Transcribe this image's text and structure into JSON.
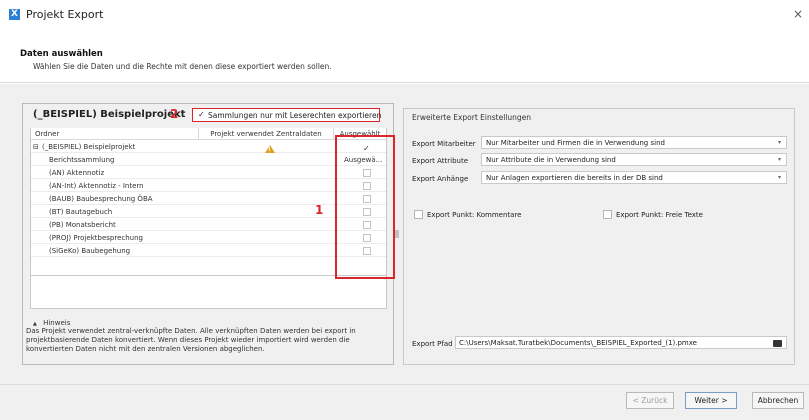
{
  "window": {
    "title": "Projekt Export",
    "close_glyph": "×"
  },
  "header": {
    "title": "Daten auswählen",
    "subtitle": "Wählen Sie die Daten und die Rechte mit denen diese exportiert werden sollen."
  },
  "left": {
    "project_title": "(_BEISPIEL) Beispielprojekt",
    "annotation_2": "2",
    "collections_checkbox": {
      "checked": true,
      "label": "Sammlungen nur mit Leserechten exportieren",
      "tick": "✓"
    },
    "columns": [
      "Ordner",
      "Projekt verwendet Zentraldaten",
      "Ausgewählt"
    ],
    "project_row": {
      "expander": "⊟",
      "label": "(_BEISPIEL) Beispielprojekt",
      "selected_tick": "✓"
    },
    "subheader": {
      "name": "Berichtssammlung",
      "selected": "Ausgewä..."
    },
    "rows": [
      "(AN) Aktennotiz",
      "(AN-Int) Aktennotiz - Intern",
      "(BAUB) Baubesprechung ÖBA",
      "(BT) Bautagebuch",
      "(PB) Monatsbericht",
      "(PROJ) Projektbesprechung",
      "(SiGeKo) Baubegehung"
    ],
    "annotation_1": "1",
    "hint": {
      "toggle": "▲",
      "title": "Hinweis",
      "text": "Das Projekt verwendet zentral-verknüpfte Daten. Alle verknüpften Daten werden bei export in projektbasierende Daten konvertiert. Wenn dieses Projekt wieder importiert wird werden die konvertierten Daten nicht mit den zentralen Versionen abgeglichen."
    }
  },
  "right": {
    "title": "Erweiterte Export Einstellungen",
    "settings": [
      {
        "label": "Export Mitarbeiter",
        "value": "Nur Mitarbeiter und Firmen die in Verwendung sind"
      },
      {
        "label": "Export Attribute",
        "value": "Nur Attribute die in Verwendung sind"
      },
      {
        "label": "Export Anhänge",
        "value": "Nur Anlagen exportieren die bereits in der DB sind"
      }
    ],
    "caret": "▾",
    "checkboxes": [
      {
        "label": "Export Punkt: Kommentare",
        "checked": false
      },
      {
        "label": "Export Punkt: Freie Texte",
        "checked": false
      }
    ],
    "path_label": "Export Pfad",
    "path_value": "C:\\Users\\Maksat.Turatbek\\Documents\\_BEISPIEL_Exported_(1).pmxe"
  },
  "footer": {
    "back": "< Zurück",
    "next": "Weiter >",
    "cancel": "Abbrechen"
  },
  "colors": {
    "accent_red": "#d9262b",
    "warning": "#e0a020",
    "app_blue": "#2b7fd4"
  }
}
